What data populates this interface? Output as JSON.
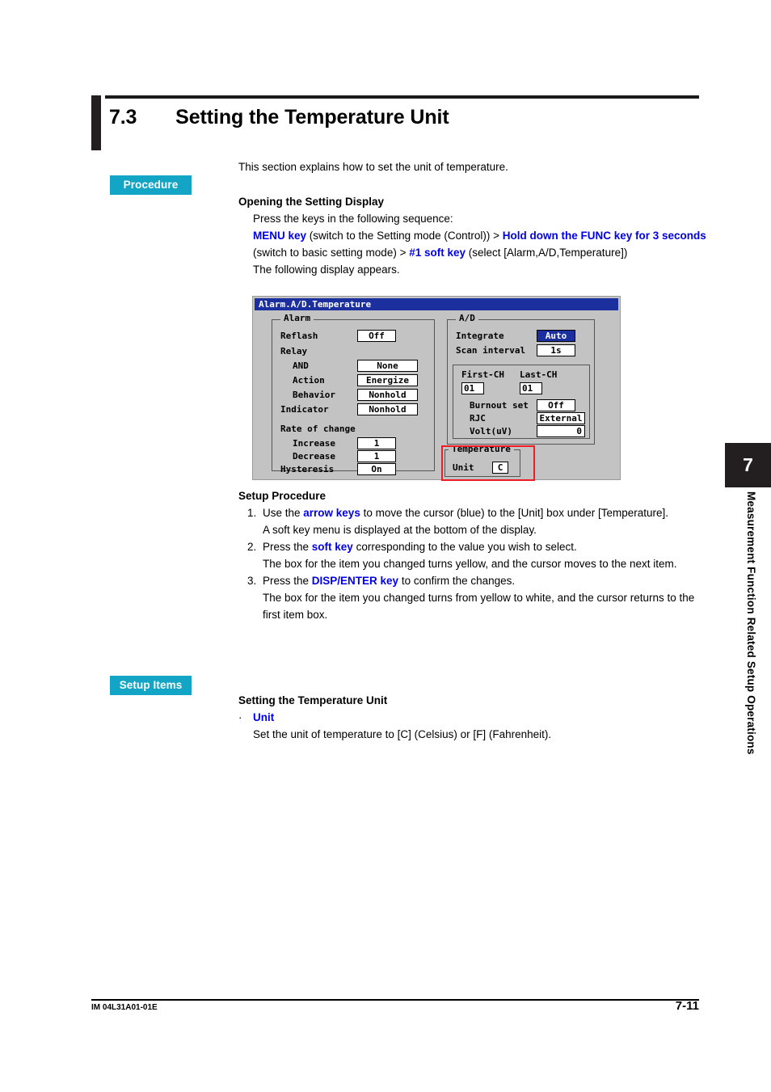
{
  "section": {
    "number": "7.3",
    "title": "Setting the Temperature Unit",
    "intro": "This section explains how to set the unit of temperature."
  },
  "badges": {
    "procedure": "Procedure",
    "setup_items": "Setup Items"
  },
  "opening": {
    "heading": "Opening the Setting Display",
    "line1": "Press the keys in the following sequence:",
    "key1": "MENU key",
    "after_key1": " (switch to the Setting mode (Control)) > ",
    "key2": "Hold down the FUNC key for 3 seconds",
    "after_key2": " (switch to basic setting mode) > ",
    "key3": "#1 soft key",
    "after_key3": " (select [Alarm,A/D,Temperature])",
    "line_last": "The following display appears."
  },
  "display": {
    "titlebar": "Alarm.A/D.Temperature",
    "alarm": {
      "legend": "Alarm",
      "reflash_label": "Reflash",
      "reflash_value": "Off",
      "relay_label": "Relay",
      "and_label": "AND",
      "and_value": "None",
      "action_label": "Action",
      "action_value": "Energize",
      "behavior_label": "Behavior",
      "behavior_value": "Nonhold",
      "indicator_label": "Indicator",
      "indicator_value": "Nonhold",
      "rate_label": "Rate of change",
      "increase_label": "Increase",
      "increase_value": "1",
      "decrease_label": "Decrease",
      "decrease_value": "1",
      "hysteresis_label": "Hysteresis",
      "hysteresis_value": "On"
    },
    "ad": {
      "legend": "A/D",
      "integrate_label": "Integrate",
      "integrate_value": "Auto",
      "scan_label": "Scan interval",
      "scan_value": "1s",
      "first_ch_label": "First-CH",
      "first_ch_value": "01",
      "last_ch_label": "Last-CH",
      "last_ch_value": "01",
      "burnout_label": "Burnout set",
      "burnout_value": "Off",
      "rjc_label": "RJC",
      "rjc_value": "External",
      "volt_label": "Volt(uV)",
      "volt_value": "0"
    },
    "temperature": {
      "legend": "Temperature",
      "unit_label": "Unit",
      "unit_value": "C"
    },
    "colors": {
      "titlebar_bg": "#1b2f9e",
      "cursor_bg": "#1b2f9e",
      "panel_bg": "#c3c3c3",
      "highlight_border": "#ee1c25"
    }
  },
  "setup_procedure": {
    "heading": "Setup Procedure",
    "steps": [
      {
        "pre": "Use the ",
        "key": "arrow keys",
        "post": " to move the cursor (blue) to the [Unit] box under [Temperature].",
        "sub": "A soft key menu is displayed at the bottom of the display."
      },
      {
        "pre": "Press the ",
        "key": "soft key",
        "post": " corresponding to the value you wish to select.",
        "sub": "The box for the item you changed turns yellow, and the cursor moves to the next item."
      },
      {
        "pre": "Press the ",
        "key": "DISP/ENTER key",
        "post": " to confirm the changes.",
        "sub": "The box for the item you changed turns from yellow to white, and the cursor returns to the first item box."
      }
    ]
  },
  "setup_items": {
    "heading": "Setting the Temperature Unit",
    "bullet_mark": "·",
    "item_label": "Unit",
    "item_desc": "Set the unit of temperature to [C] (Celsius) or [F] (Fahrenheit)."
  },
  "chapter": {
    "number": "7",
    "vertical_title": "Measurement Function Related Setup Operations"
  },
  "footer": {
    "left": "IM 04L31A01-01E",
    "right": "7-11"
  }
}
